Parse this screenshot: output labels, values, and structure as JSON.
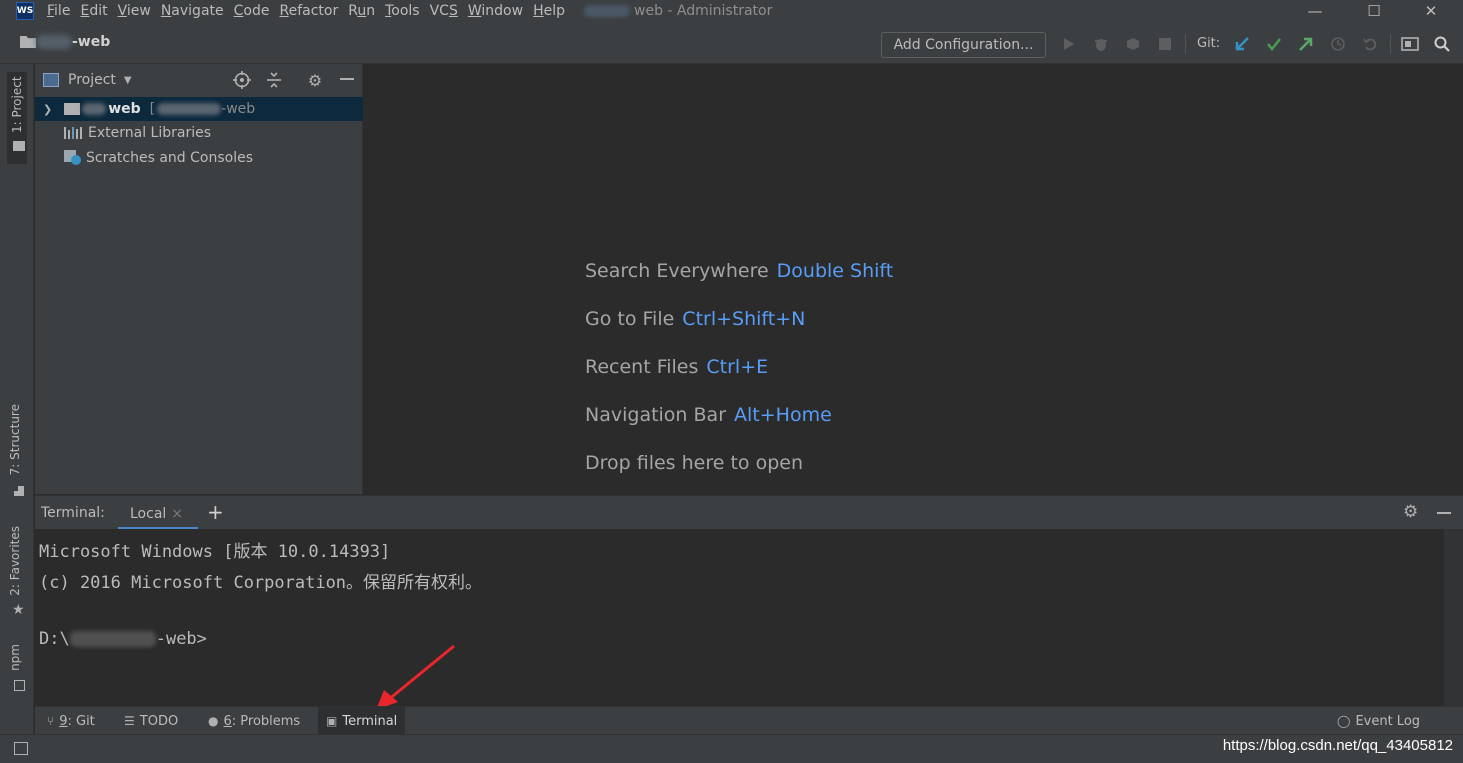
{
  "window": {
    "app_logo": "WS",
    "title": "web - Administrator",
    "menu": [
      {
        "label": "File",
        "mnemonic": "F"
      },
      {
        "label": "Edit",
        "mnemonic": "E"
      },
      {
        "label": "View",
        "mnemonic": "V"
      },
      {
        "label": "Navigate",
        "mnemonic": "N"
      },
      {
        "label": "Code",
        "mnemonic": "C"
      },
      {
        "label": "Refactor",
        "mnemonic": "R"
      },
      {
        "label": "Run",
        "mnemonic": "u"
      },
      {
        "label": "Tools",
        "mnemonic": "T"
      },
      {
        "label": "VCS",
        "mnemonic": "S"
      },
      {
        "label": "Window",
        "mnemonic": "W"
      },
      {
        "label": "Help",
        "mnemonic": "H"
      }
    ],
    "controls": {
      "minimize": "—",
      "maximize": "☐",
      "close": "✕"
    }
  },
  "navbar": {
    "project_name": "-web",
    "add_configuration": "Add Configuration...",
    "git_label": "Git:"
  },
  "left_stripe": {
    "project_tab": "1: Project",
    "structure_tab": "7: Structure",
    "favorites_tab": "2: Favorites",
    "npm_tab": "npm"
  },
  "project_panel": {
    "title": "Project",
    "tree": {
      "root_name": "web",
      "root_path_prefix": "[",
      "root_path_suffix": "-web",
      "external_libraries": "External Libraries",
      "scratches": "Scratches and Consoles"
    }
  },
  "editor": {
    "hints": [
      {
        "text": "Search Everywhere",
        "shortcut": "Double Shift"
      },
      {
        "text": "Go to File",
        "shortcut": "Ctrl+Shift+N"
      },
      {
        "text": "Recent Files",
        "shortcut": "Ctrl+E"
      },
      {
        "text": "Navigation Bar",
        "shortcut": "Alt+Home"
      },
      {
        "text": "Drop files here to open",
        "shortcut": ""
      }
    ]
  },
  "terminal": {
    "label": "Terminal:",
    "tab": "Local",
    "tab_close": "×",
    "add": "+",
    "lines": [
      "Microsoft Windows [版本 10.0.14393]",
      "(c) 2016 Microsoft Corporation。保留所有权利。",
      "",
      "D:\\"
    ],
    "prompt_suffix": "-web>"
  },
  "bottom_tabs": {
    "git": {
      "num": "9",
      "label": ": Git"
    },
    "todo": {
      "label": "TODO"
    },
    "problems": {
      "num": "6",
      "label": ": Problems"
    },
    "terminal": {
      "label": "Terminal"
    },
    "event_log": {
      "label": "Event Log"
    }
  },
  "status": {
    "watermark": "https://blog.csdn.net/qq_43405812"
  },
  "colors": {
    "accent_blue": "#589df6",
    "selection": "#0d293e",
    "panel_bg": "#3c3f41",
    "editor_bg": "#2b2b2b",
    "git_update": "#3592c4",
    "git_commit": "#499c54",
    "git_push": "#59a869",
    "arrow_red": "#e8262c"
  }
}
